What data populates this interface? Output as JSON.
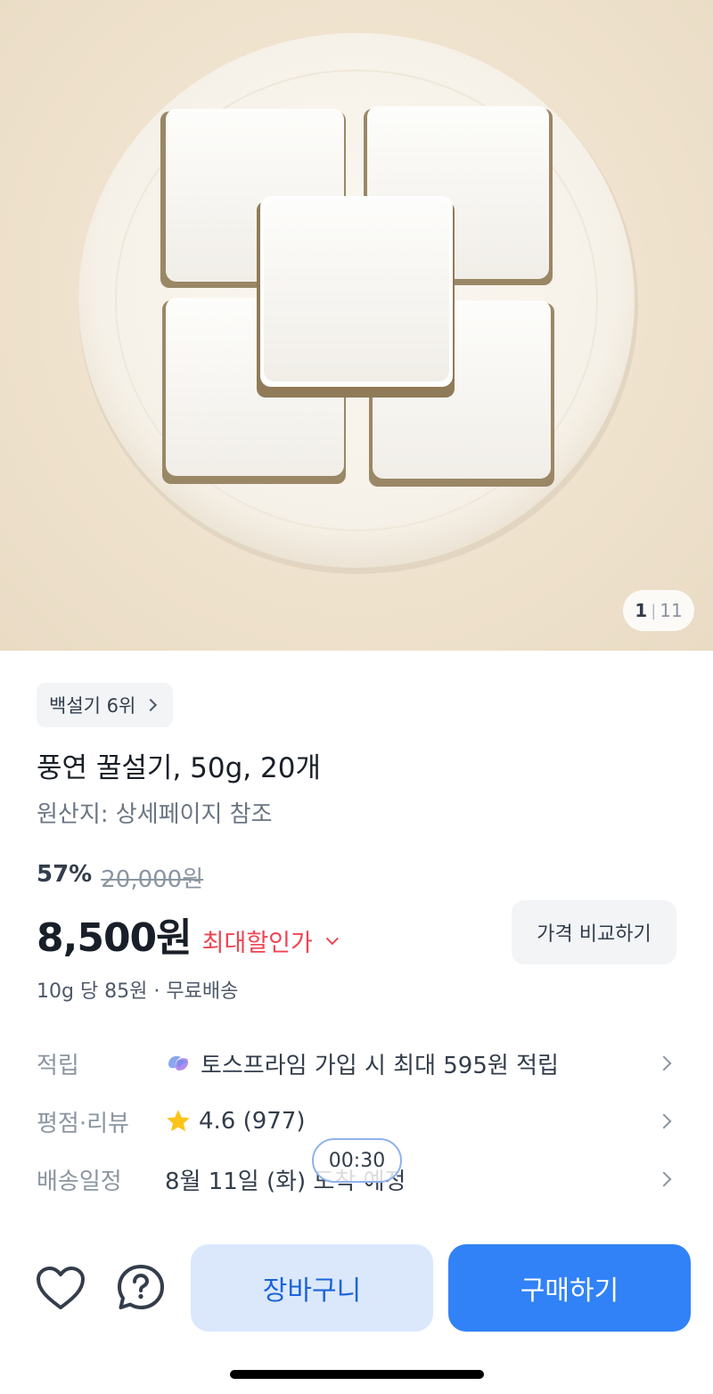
{
  "gallery": {
    "current": "1",
    "total": "11"
  },
  "ranking": {
    "label": "백설기 6위"
  },
  "product": {
    "title": "풍연 꿀설기, 50g, 20개",
    "origin": "원산지: 상세페이지 참조"
  },
  "price": {
    "discount_rate": "57%",
    "original": "20,000원",
    "final": "8,500원",
    "max_discount_label": "최대할인가",
    "compare_label": "가격 비교하기",
    "unit_info": "10g 당 85원 · 무료배송"
  },
  "info_rows": [
    {
      "label": "적립",
      "value": "토스프라임 가입 시 최대 595원 적립",
      "icon": "prime-icon"
    },
    {
      "label": "평점·리뷰",
      "value": "4.6 (977)",
      "icon": "star-icon"
    },
    {
      "label": "배송일정",
      "value": "8월 11일 (화) 도착 예정",
      "icon": ""
    }
  ],
  "timer": "00:30",
  "actions": {
    "cart_label": "장바구니",
    "buy_label": "구매하기"
  },
  "colors": {
    "accent": "#3182f6",
    "discount_red": "#f04452",
    "cart_bg": "#dbe8fc"
  }
}
